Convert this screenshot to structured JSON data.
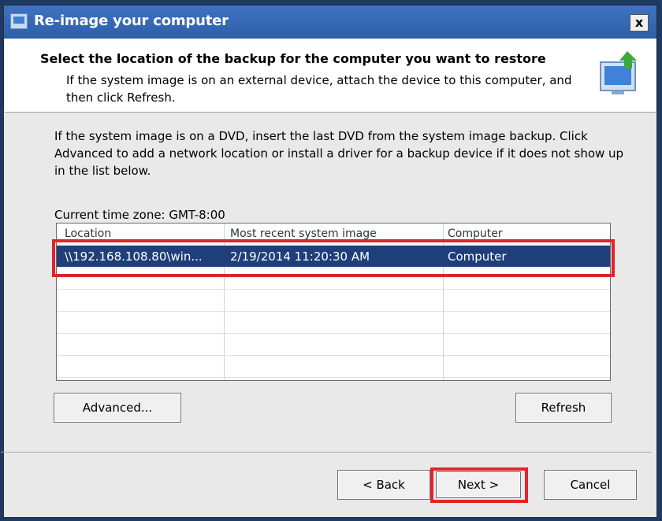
{
  "window": {
    "title": "Re-image your computer",
    "close_label": "x"
  },
  "header": {
    "title": "Select the location of the backup for the computer you want to restore",
    "description": "If the system image is on an external device, attach the device to this computer, and then click Refresh."
  },
  "instructions": "If the system image is on a DVD, insert the last DVD from the system image backup. Click Advanced to add a network location or install a driver for a backup device if it does not show up in the list below.",
  "timezone": "Current time zone: GMT-8:00",
  "table": {
    "columns": [
      "Location",
      "Most recent system image",
      "Computer"
    ],
    "rows": [
      {
        "location": "\\\\192.168.108.80\\win...",
        "date": "2/19/2014 11:20:30 AM",
        "computer": "Computer"
      }
    ]
  },
  "buttons": {
    "advanced": "Advanced...",
    "refresh": "Refresh",
    "back": "< Back",
    "next": "Next >",
    "cancel": "Cancel"
  },
  "colors": {
    "titlebar": "#2f5ea8",
    "selection": "#1f3f7a",
    "highlight": "#e0242c"
  }
}
